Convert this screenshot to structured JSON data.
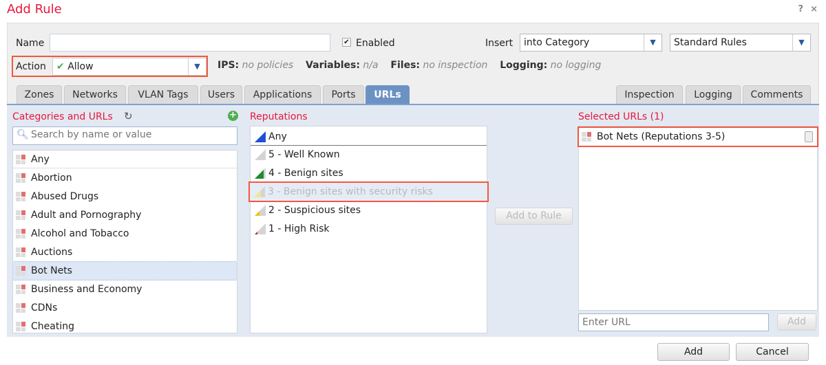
{
  "dialog": {
    "title": "Add Rule",
    "help": "?",
    "close": "×"
  },
  "form": {
    "name_label": "Name",
    "name_value": "",
    "enabled_label": "Enabled",
    "enabled_checked": true,
    "insert_label": "Insert",
    "insert_value": "into Category",
    "category_value": "Standard Rules",
    "action_label": "Action",
    "action_value": "Allow"
  },
  "info": {
    "ips_label": "IPS:",
    "ips_value": "no policies",
    "variables_label": "Variables:",
    "variables_value": "n/a",
    "files_label": "Files:",
    "files_value": "no inspection",
    "logging_label": "Logging:",
    "logging_value": "no logging"
  },
  "tabs_left": [
    "Zones",
    "Networks",
    "VLAN Tags",
    "Users",
    "Applications",
    "Ports",
    "URLs"
  ],
  "active_tab": "URLs",
  "tabs_right": [
    "Inspection",
    "Logging",
    "Comments"
  ],
  "categories": {
    "header": "Categories and URLs",
    "search_placeholder": "Search by name or value",
    "items": [
      "Any",
      "Abortion",
      "Abused Drugs",
      "Adult and Pornography",
      "Alcohol and Tobacco",
      "Auctions",
      "Bot Nets",
      "Business and Economy",
      "CDNs",
      "Cheating"
    ],
    "selected": "Bot Nets"
  },
  "reputations": {
    "header": "Reputations",
    "items": [
      {
        "label": "Any",
        "color": "#1f4fd8"
      },
      {
        "label": "5 - Well Known",
        "color": "#cccccc"
      },
      {
        "label": "4 - Benign sites",
        "color": "#1e8c2e"
      },
      {
        "label": "3 - Benign sites with security risks",
        "color": "#f0e68c"
      },
      {
        "label": "2 - Suspicious sites",
        "color": "#f2c400"
      },
      {
        "label": "1 - High Risk",
        "color": "#c0221a"
      }
    ],
    "selected": "3 - Benign sites with security risks"
  },
  "add_to_rule": "Add to Rule",
  "selected_urls": {
    "header": "Selected URLs (1)",
    "items": [
      "Bot Nets (Reputations 3-5)"
    ],
    "enter_placeholder": "Enter URL",
    "add_label": "Add"
  },
  "footer": {
    "add": "Add",
    "cancel": "Cancel"
  }
}
